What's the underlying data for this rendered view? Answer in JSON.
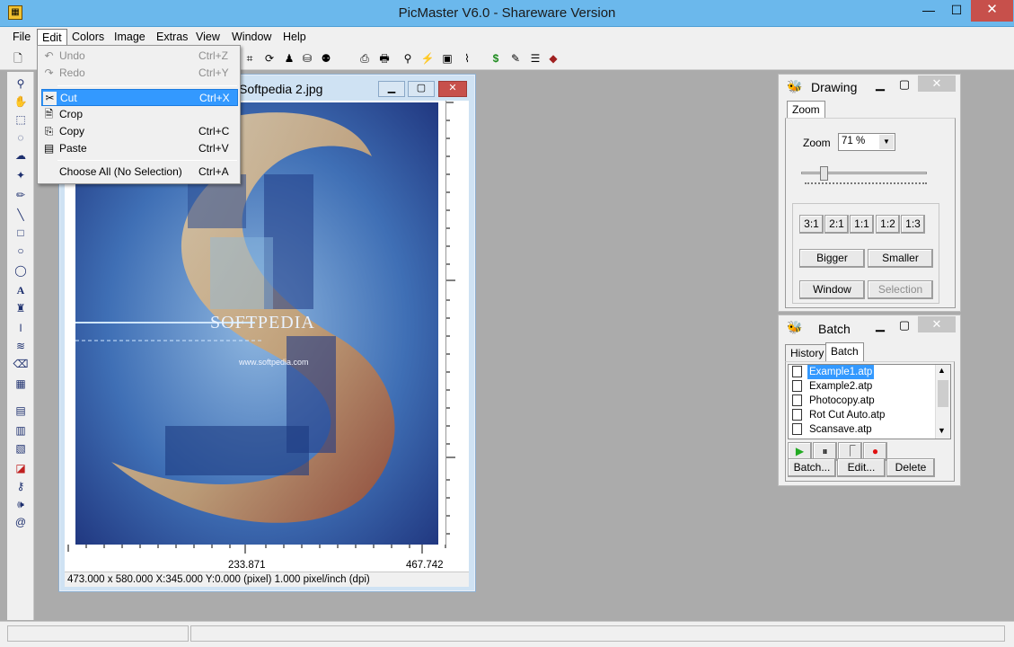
{
  "app": {
    "title": "PicMaster V6.0 - Shareware Version",
    "window_controls": {
      "minimize": "—",
      "maximize": "☐",
      "close": "✕"
    }
  },
  "menubar": {
    "items": [
      "File",
      "Edit",
      "Colors",
      "Image",
      "Extras",
      "View",
      "Window",
      "Help"
    ]
  },
  "edit_menu": {
    "items": [
      {
        "label": "Undo",
        "shortcut": "Ctrl+Z",
        "disabled": true,
        "icon": "undo-icon"
      },
      {
        "label": "Redo",
        "shortcut": "Ctrl+Y",
        "disabled": true,
        "icon": "redo-icon"
      },
      {
        "label": "Cut",
        "shortcut": "Ctrl+X",
        "highlighted": true,
        "icon": "scissors-icon"
      },
      {
        "label": "Crop",
        "shortcut": "",
        "icon": "crop-icon"
      },
      {
        "label": "Copy",
        "shortcut": "Ctrl+C",
        "icon": "copy-icon"
      },
      {
        "label": "Paste",
        "shortcut": "Ctrl+V",
        "icon": "paste-icon"
      },
      {
        "label": "Choose All (No Selection)",
        "shortcut": "Ctrl+A"
      }
    ]
  },
  "image_window": {
    "title": "Softpedia 2.jpg",
    "ruler_labels": [
      "233.871",
      "467.742"
    ],
    "status": "473.000 x 580.000   X:345.000  Y:0.000 (pixel)  1.000 pixel/inch (dpi)",
    "overlay_text": "SOFTPEDIA",
    "overlay_url": "www.softpedia.com"
  },
  "drawing_panel": {
    "title": "Drawing",
    "tab": "Zoom",
    "zoom_label": "Zoom",
    "zoom_value": "71 %",
    "zoom_slider": 0.15,
    "ratio_buttons": [
      "3:1",
      "2:1",
      "1:1",
      "1:2",
      "1:3"
    ],
    "bigger": "Bigger",
    "smaller": "Smaller",
    "window": "Window",
    "selection": "Selection"
  },
  "batch_panel": {
    "title": "Batch",
    "tabs": [
      "History",
      "Batch"
    ],
    "files": [
      "Example1.atp",
      "Example2.atp",
      "Photocopy.atp",
      "Rot Cut Auto.atp",
      "Scansave.atp"
    ],
    "buttons": {
      "batch": "Batch...",
      "edit": "Edit...",
      "delete": "Delete"
    }
  },
  "colors": {
    "titlebar": "#6bb8ec",
    "highlight": "#3399ff",
    "close": "#c7504b"
  }
}
